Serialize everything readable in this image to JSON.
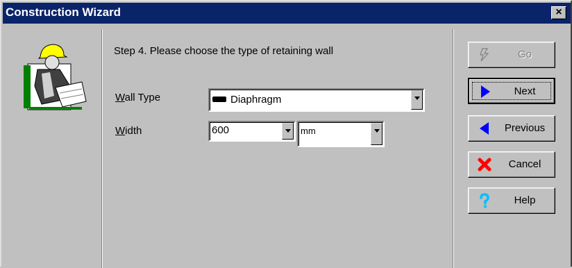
{
  "window": {
    "title": "Construction Wizard",
    "close_label": "×"
  },
  "step_text": "Step 4. Please choose the type of retaining wall",
  "wall_type": {
    "label_accel": "W",
    "label_rest": "all Type",
    "value": "Diaphragm"
  },
  "width": {
    "label_accel": "W",
    "label_rest": "idth",
    "value": "600",
    "unit": "mm"
  },
  "buttons": {
    "go": "Go",
    "next": "Next",
    "previous": "Previous",
    "cancel": "Cancel",
    "help": "Help"
  },
  "icons": {
    "mascot": "construction-worker-icon",
    "go": "lightning-icon",
    "next": "arrow-right-icon",
    "previous": "arrow-left-icon",
    "cancel": "red-x-icon",
    "help": "question-mark-icon"
  },
  "colors": {
    "titlebar": "#0a246a",
    "face": "#c0c0c0",
    "arrow_blue": "#0000ff",
    "cancel_red": "#ff0000",
    "help_cyan": "#00c0ff"
  }
}
